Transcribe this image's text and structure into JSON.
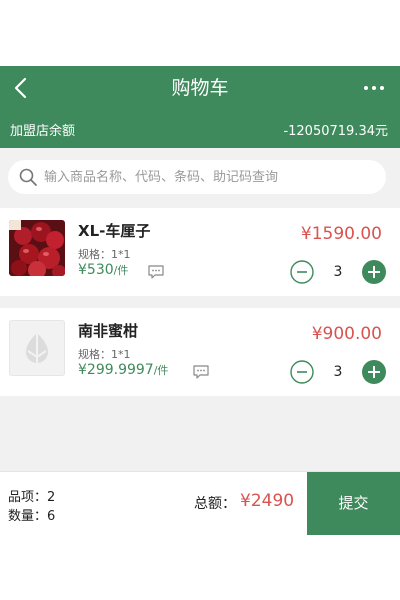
{
  "header": {
    "title": "购物车",
    "back_icon": "back-arrow-icon",
    "more_icon": "more-dots-icon",
    "balance_label": "加盟店余额",
    "balance_value": "-12050719.34元",
    "bg_color": "#3f8a5c"
  },
  "search": {
    "placeholder": "输入商品名称、代码、条码、助记码查询",
    "icon": "search-icon"
  },
  "items": [
    {
      "name": "XL-车厘子",
      "spec": "规格：1*1",
      "price": "¥530",
      "unit": "/件",
      "subtotal": "¥1590.00",
      "qty": "3",
      "image": "cherry-product-image"
    },
    {
      "name": "南非蜜柑",
      "spec": "规格：1*1",
      "price": "¥299.9997",
      "unit": "/件",
      "subtotal": "¥900.00",
      "qty": "3",
      "image": "placeholder-product-image"
    }
  ],
  "footer": {
    "item_types": "品项：2",
    "quantity": "数量：6",
    "total_label": "总额：",
    "total_value": "¥2490",
    "submit_label": "提交"
  },
  "colors": {
    "accent_green": "#3f8a5c",
    "price_red": "#d9534f"
  }
}
